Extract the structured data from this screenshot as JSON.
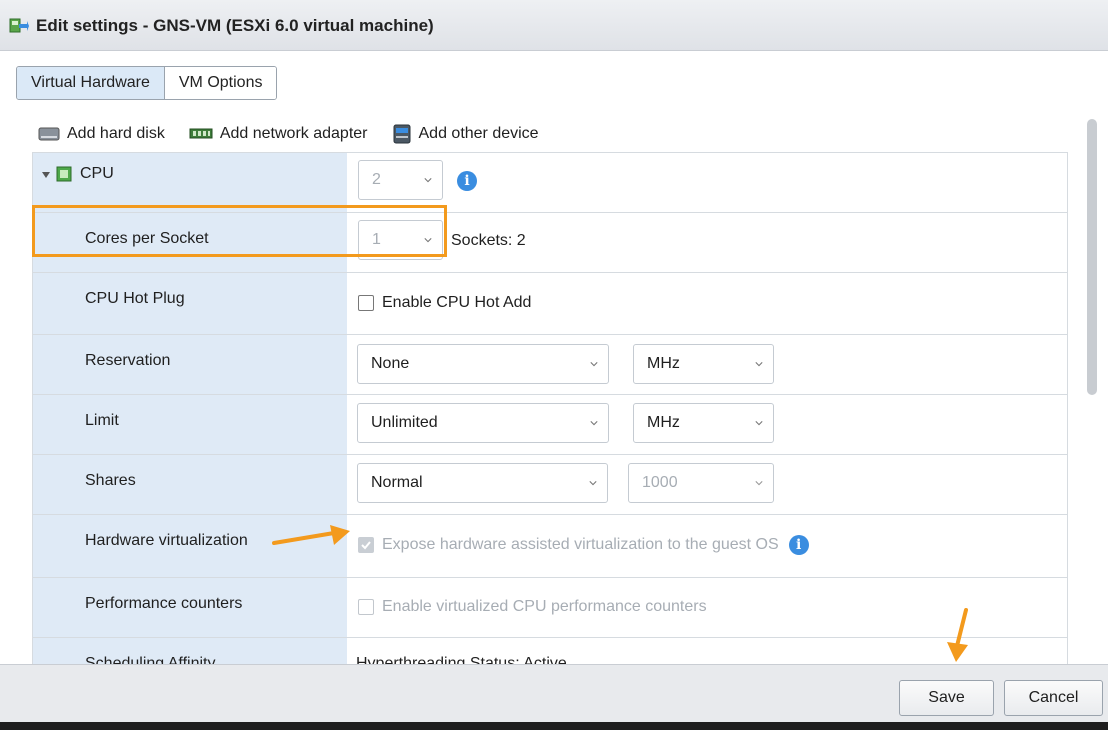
{
  "window": {
    "title": "Edit settings - GNS-VM (ESXi 6.0 virtual machine)"
  },
  "tabs": [
    {
      "label": "Virtual Hardware",
      "active": true
    },
    {
      "label": "VM Options",
      "active": false
    }
  ],
  "toolbar": {
    "add_hard_disk": "Add hard disk",
    "add_network_adapter": "Add network adapter",
    "add_other_device": "Add other device"
  },
  "cpu": {
    "label": "CPU",
    "value": "2",
    "cores_per_socket": {
      "label": "Cores per Socket",
      "value": "1",
      "sockets": "Sockets: 2"
    },
    "hot_plug": {
      "label": "CPU Hot Plug",
      "checkbox_label": "Enable CPU Hot Add",
      "checked": false
    },
    "reservation": {
      "label": "Reservation",
      "value": "None",
      "unit": "MHz"
    },
    "limit": {
      "label": "Limit",
      "value": "Unlimited",
      "unit": "MHz"
    },
    "shares": {
      "label": "Shares",
      "value": "Normal",
      "number": "1000"
    },
    "hw_virt": {
      "label": "Hardware virtualization",
      "checkbox_label": "Expose hardware assisted virtualization to the guest OS",
      "checked": true
    },
    "perf_counters": {
      "label": "Performance counters",
      "checkbox_label": "Enable virtualized CPU performance counters",
      "checked": false
    },
    "affinity": {
      "label": "Scheduling Affinity",
      "status": "Hyperthreading Status: Active"
    }
  },
  "footer": {
    "save_label": "Save",
    "cancel_label": "Cancel"
  },
  "colors": {
    "accent_highlight": "#f39a1d",
    "label_column": "#dfeaf6",
    "info": "#3a8de0",
    "tab_active": "#dbe9f7"
  },
  "icons": [
    "vm-edit-icon",
    "hard-disk-icon",
    "network-adapter-icon",
    "other-device-icon",
    "cpu-chip-icon",
    "expand-triangle-icon",
    "info-icon",
    "chevron-down-icon",
    "arrow-annotation-icon"
  ]
}
